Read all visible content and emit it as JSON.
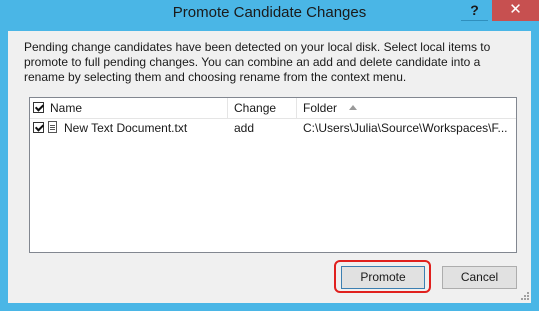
{
  "window": {
    "title": "Promote Candidate Changes",
    "help_label": "?",
    "close_label": "✕"
  },
  "instructions": "Pending change candidates have been detected on your local disk. Select local items to promote to full pending changes. You can combine an add and delete candidate into a rename by selecting them and choosing rename from the context menu.",
  "list": {
    "columns": {
      "name": "Name",
      "change": "Change",
      "folder": "Folder"
    },
    "sort_column": "folder",
    "sort_direction": "ascending",
    "header_checked": true,
    "rows": [
      {
        "checked": true,
        "icon": "text-document-icon",
        "name": "New Text Document.txt",
        "change": "add",
        "folder": "C:\\Users\\Julia\\Source\\Workspaces\\F..."
      }
    ]
  },
  "buttons": {
    "promote": "Promote",
    "cancel": "Cancel"
  },
  "colors": {
    "title_bar": "#4ab6e6",
    "close_button": "#c75050",
    "highlight": "#e0201e"
  }
}
